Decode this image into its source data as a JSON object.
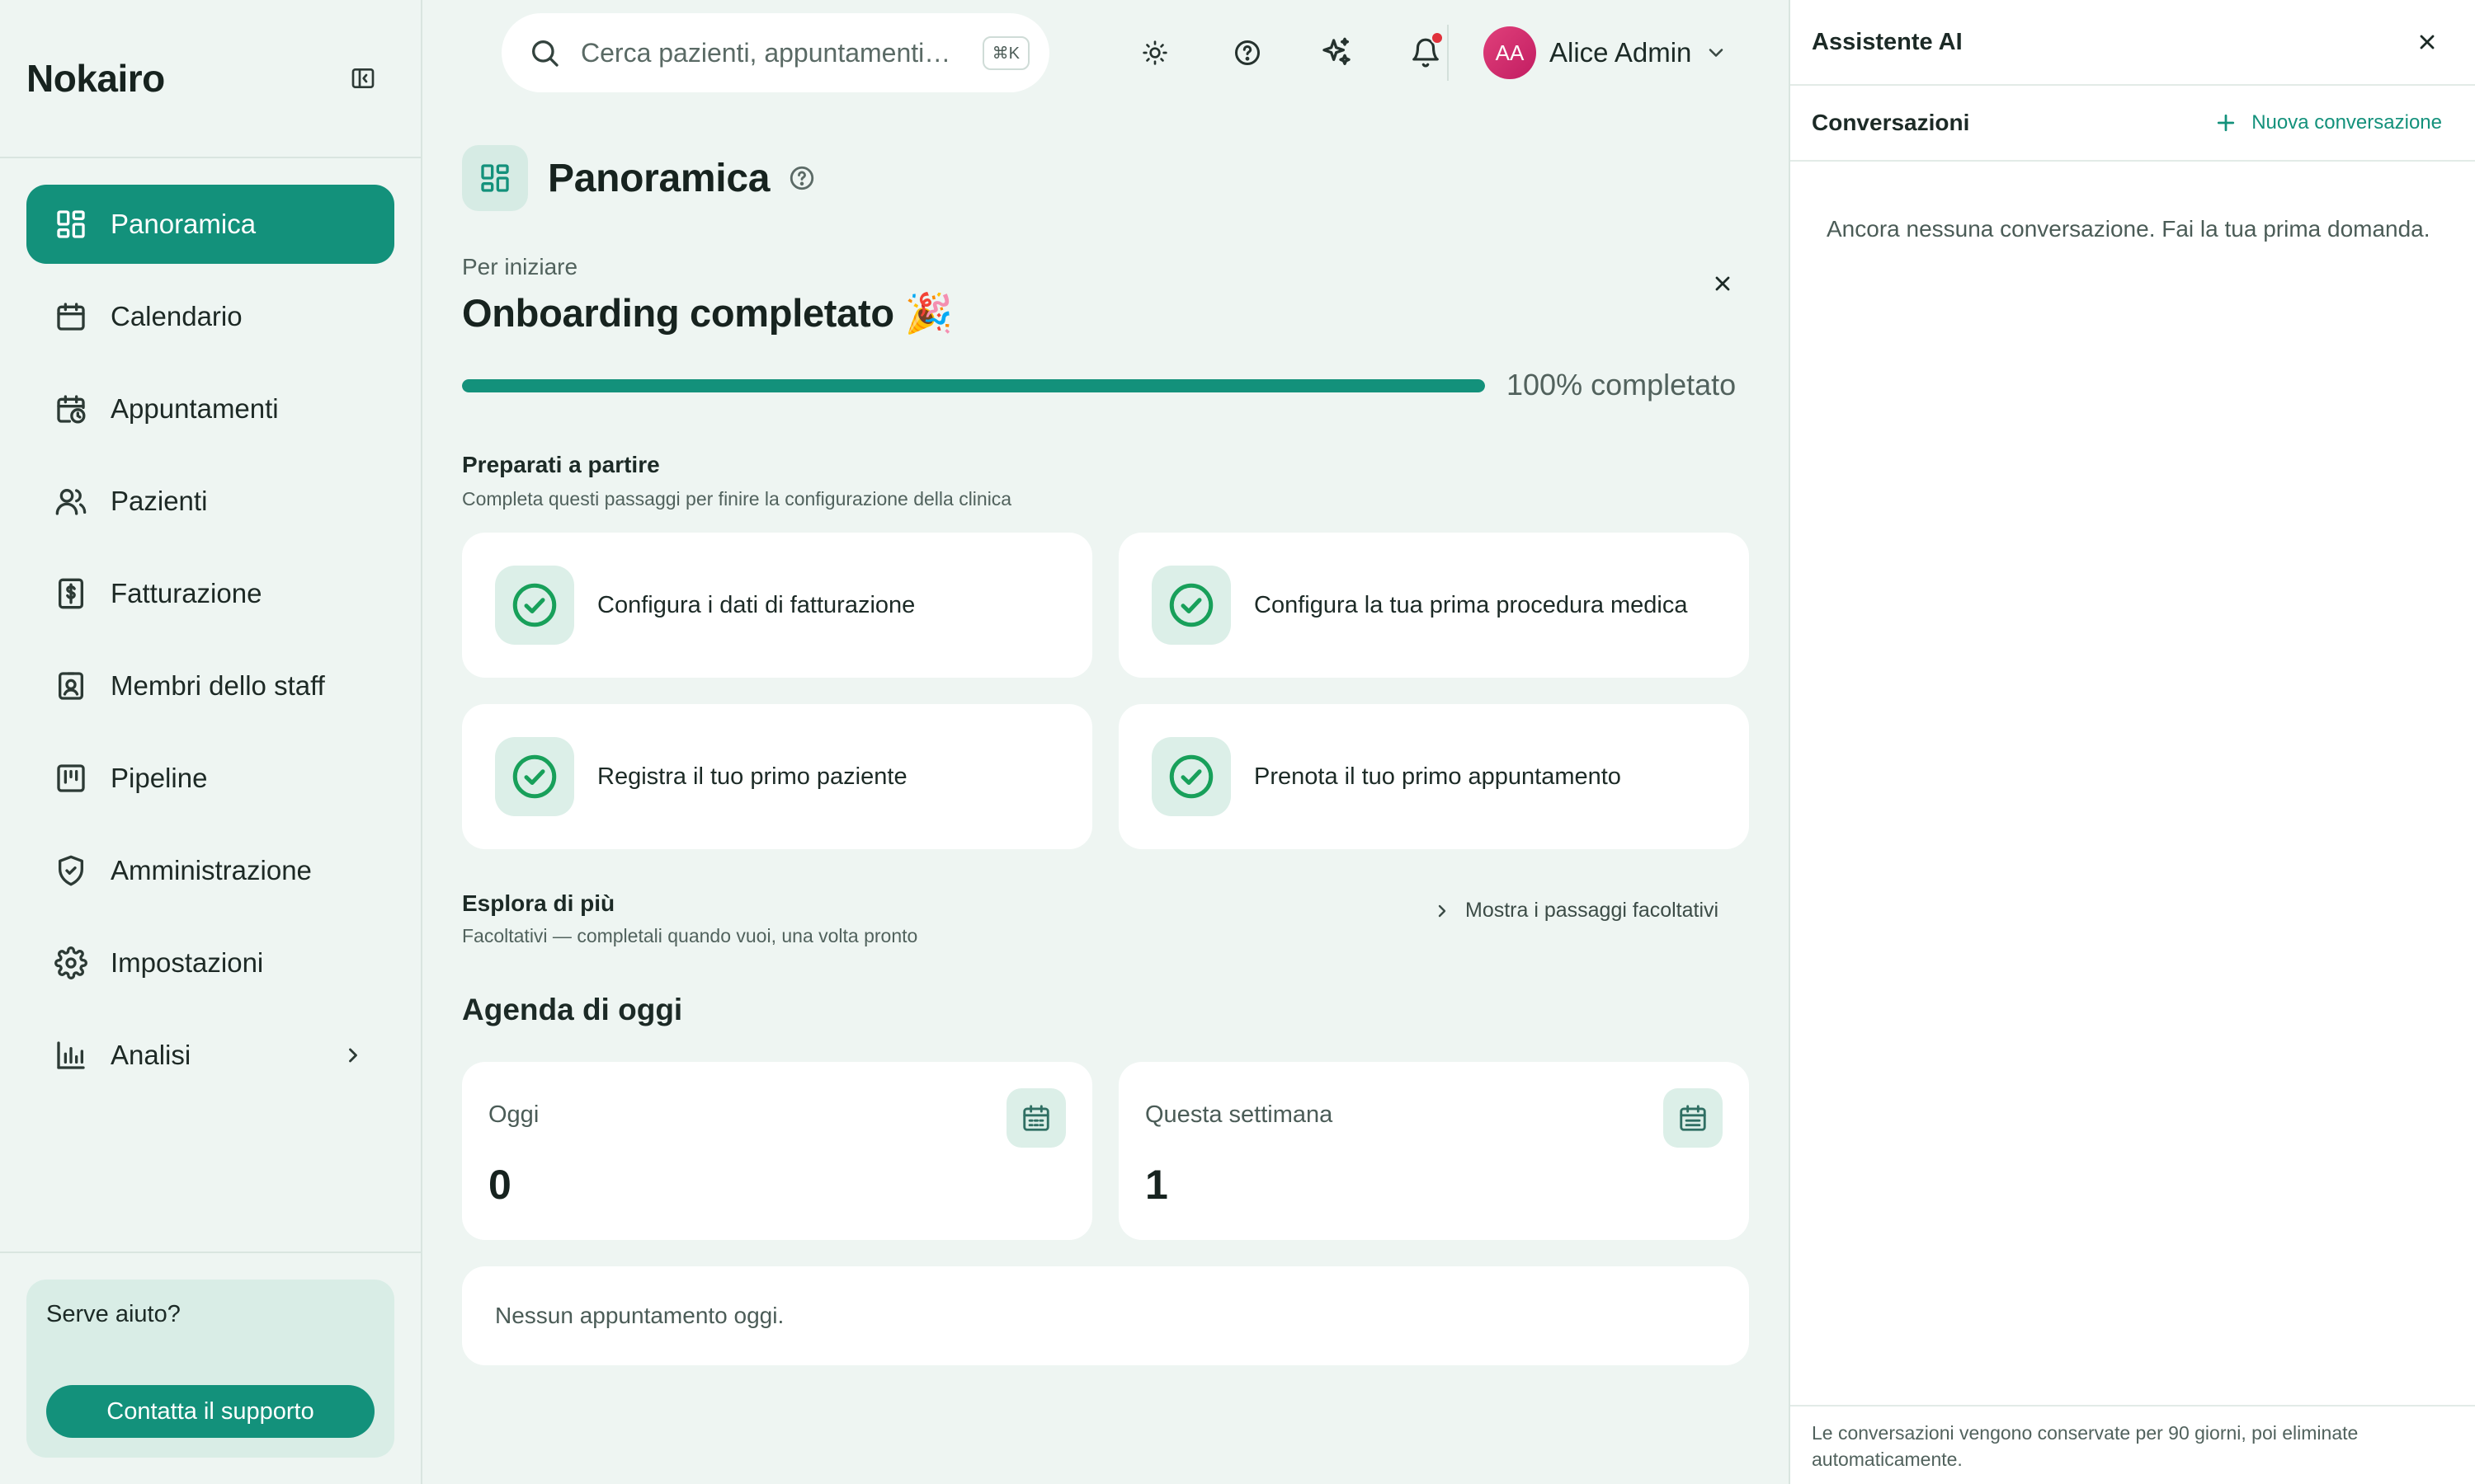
{
  "app": {
    "brand": "Nokairo"
  },
  "sidebar": {
    "items": [
      {
        "label": "Panoramica",
        "icon": "dashboard-grid-icon",
        "active": true
      },
      {
        "label": "Calendario",
        "icon": "calendar-icon"
      },
      {
        "label": "Appuntamenti",
        "icon": "calendar-clock-icon"
      },
      {
        "label": "Pazienti",
        "icon": "users-icon"
      },
      {
        "label": "Fatturazione",
        "icon": "receipt-dollar-icon"
      },
      {
        "label": "Membri dello staff",
        "icon": "id-badge-icon"
      },
      {
        "label": "Pipeline",
        "icon": "kanban-icon"
      },
      {
        "label": "Amministrazione",
        "icon": "shield-check-icon"
      },
      {
        "label": "Impostazioni",
        "icon": "gear-icon"
      },
      {
        "label": "Analisi",
        "icon": "bar-chart-icon",
        "has_submenu": true
      }
    ],
    "help": {
      "title": "Serve aiuto?",
      "button": "Contatta il supporto"
    }
  },
  "topbar": {
    "search": {
      "placeholder": "Cerca pazienti, appuntamenti…",
      "shortcut": "⌘K"
    },
    "user": {
      "initials": "AA",
      "name": "Alice Admin"
    },
    "notifications_unread": true
  },
  "page": {
    "title": "Panoramica",
    "onboarding": {
      "eyebrow": "Per iniziare",
      "title": "Onboarding completato 🎉",
      "progress_percent": 100,
      "progress_label": "100% completato"
    },
    "prepare": {
      "title": "Preparati a partire",
      "subtitle": "Completa questi passaggi per finire la configurazione della clinica",
      "tasks": [
        {
          "label": "Configura i dati di fatturazione",
          "done": true
        },
        {
          "label": "Configura la tua prima procedura medica",
          "done": true
        },
        {
          "label": "Registra il tuo primo paziente",
          "done": true
        },
        {
          "label": "Prenota il tuo primo appuntamento",
          "done": true
        }
      ]
    },
    "explore": {
      "title": "Esplora di più",
      "subtitle": "Facoltativi — completali quando vuoi, una volta pronto",
      "toggle": "Mostra i passaggi facoltativi"
    },
    "agenda": {
      "title": "Agenda di oggi",
      "stats": [
        {
          "label": "Oggi",
          "value": "0"
        },
        {
          "label": "Questa settimana",
          "value": "1"
        }
      ],
      "empty": "Nessun appuntamento oggi."
    }
  },
  "ai_panel": {
    "title": "Assistente AI",
    "conversations_title": "Conversazioni",
    "new_conversation": "Nuova conversazione",
    "empty": "Ancora nessuna conversazione. Fai la tua prima domanda.",
    "footer": "Le conversazioni vengono conservate per 90 giorni, poi eliminate automaticamente."
  },
  "colors": {
    "accent": "#13917b",
    "background": "#eef5f2",
    "success": "#18a05a",
    "danger": "#e0313b"
  }
}
